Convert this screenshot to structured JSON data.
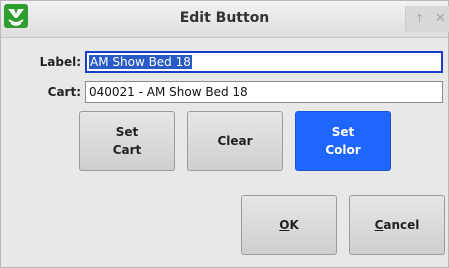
{
  "window": {
    "title": "Edit Button",
    "app_icon": "app-logo-icon",
    "titlebar_buttons": {
      "pin_glyph": "↑",
      "close_glyph": "✕"
    }
  },
  "form": {
    "label_caption": "Label:",
    "label_value": "AM Show Bed 18",
    "cart_caption": "Cart:",
    "cart_value": "040021 - AM Show Bed 18"
  },
  "buttons": {
    "set_cart": "Set\nCart",
    "clear": "Clear",
    "set_color": "Set\nColor",
    "ok_underlined": "O",
    "ok_rest": "K",
    "cancel_underlined": "C",
    "cancel_rest": "ancel"
  },
  "colors": {
    "accent_blue": "#1f66ff",
    "selection": "#2a5ac8",
    "app_icon_green": "#2e9e2e"
  }
}
